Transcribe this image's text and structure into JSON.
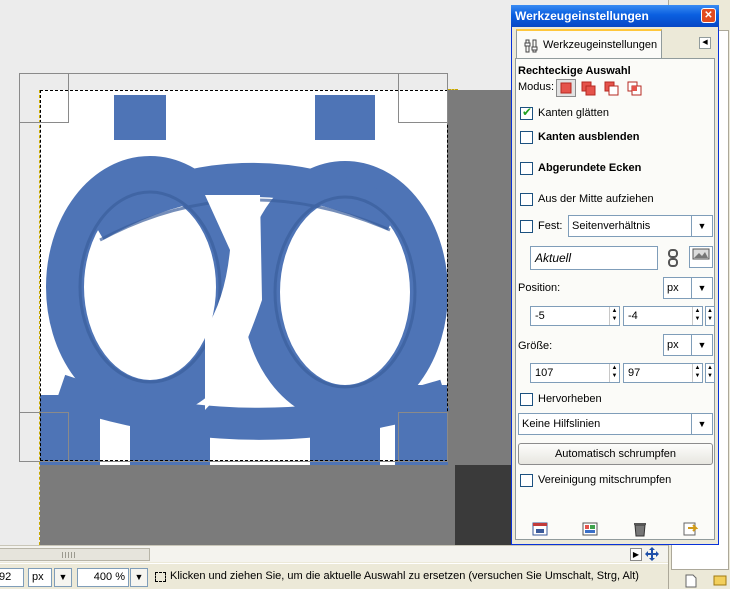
{
  "canvas": {
    "image_description_colors": {
      "ink": "#4e74b6",
      "paper": "#ffffff",
      "outside": "#7b7b7b"
    }
  },
  "statusbar": {
    "coord_value": "92",
    "unit": "px",
    "zoom": "400 %",
    "message": "Klicken und ziehen Sie, um die aktuelle Auswahl zu ersetzen (versuchen Sie Umschalt, Strg, Alt)"
  },
  "dock": {
    "title": "Werkzeugeinstellungen",
    "tab_label": "Werkzeugeinstellungen",
    "tool_title": "Rechteckige Auswahl",
    "mode_label": "Modus:",
    "mode_icons": [
      "mode-replace-icon",
      "mode-add-icon",
      "mode-subtract-icon",
      "mode-intersect-icon"
    ],
    "options": {
      "antialias": {
        "label": "Kanten glätten",
        "checked": true
      },
      "feather": {
        "label": "Kanten ausblenden",
        "checked": false
      },
      "rounded": {
        "label": "Abgerundete Ecken",
        "checked": false
      },
      "from_center": {
        "label": "Aus der Mitte aufziehen",
        "checked": false
      },
      "fixed": {
        "label": "Fest:",
        "checked": false,
        "value": "Seitenverhältnis"
      }
    },
    "aspect_entry": "Aktuell",
    "position": {
      "label": "Position:",
      "unit": "px",
      "x": "-5",
      "y": "-4"
    },
    "size": {
      "label": "Größe:",
      "unit": "px",
      "w": "107",
      "h": "97"
    },
    "highlight": {
      "label": "Hervorheben",
      "checked": false
    },
    "guides": "Keine Hilfslinien",
    "autoshrink_button": "Automatisch schrumpfen",
    "shrink_merged": {
      "label": "Vereinigung mitschrumpfen",
      "checked": false
    }
  }
}
